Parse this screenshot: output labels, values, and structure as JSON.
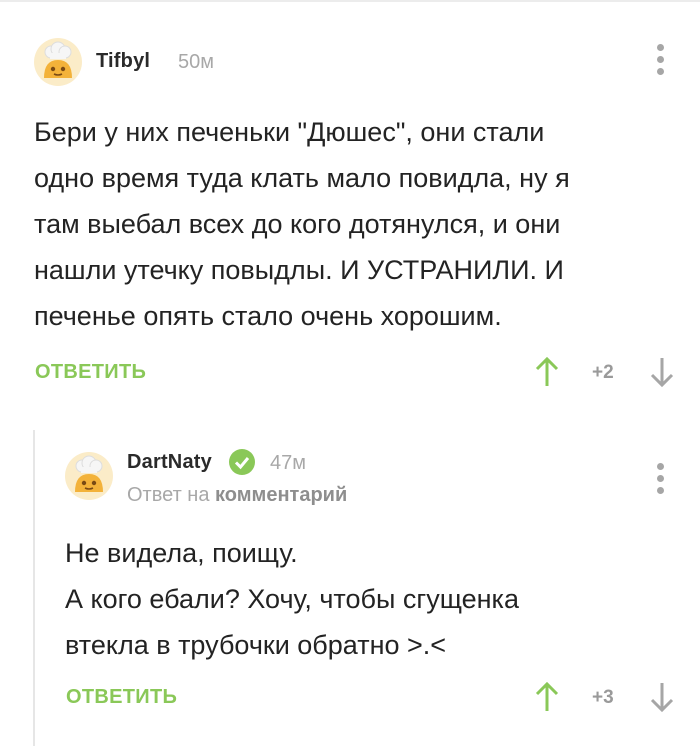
{
  "comments": [
    {
      "username": "Tifbyl",
      "time": "50м",
      "text_lines": [
        "Бери у них печеньки \"Дюшес\", они стали",
        "одно время туда клать мало повидла, ну я",
        "там выебал всех до кого дотянулся, и они",
        "нашли утечку повыдлы. И УСТРАНИЛИ. И",
        "печенье опять стало очень хорошим."
      ],
      "reply_label": "ОТВЕТИТЬ",
      "score": "+2"
    },
    {
      "username": "DartNaty",
      "verified": true,
      "time": "47м",
      "reply_to_prefix": "Ответ на",
      "reply_to_target": "комментарий",
      "text_lines": [
        "Не видела, поищу.",
        "А кого ебали? Хочу, чтобы сгущенка",
        "втекла в трубочки обратно >.<"
      ],
      "reply_label": "ОТВЕТИТЬ",
      "score": "+3"
    }
  ],
  "icons": {
    "avatar": "chef-avatar-icon",
    "more": "more-vertical-icon",
    "upvote": "arrow-up-icon",
    "downvote": "arrow-down-icon",
    "verified": "verified-check-icon"
  },
  "colors": {
    "accent_green": "#8ac858",
    "muted_gray": "#a8a8a8",
    "text": "#232323",
    "avatar_orange": "#f3b23a",
    "avatar_bg": "#fbecc8"
  }
}
